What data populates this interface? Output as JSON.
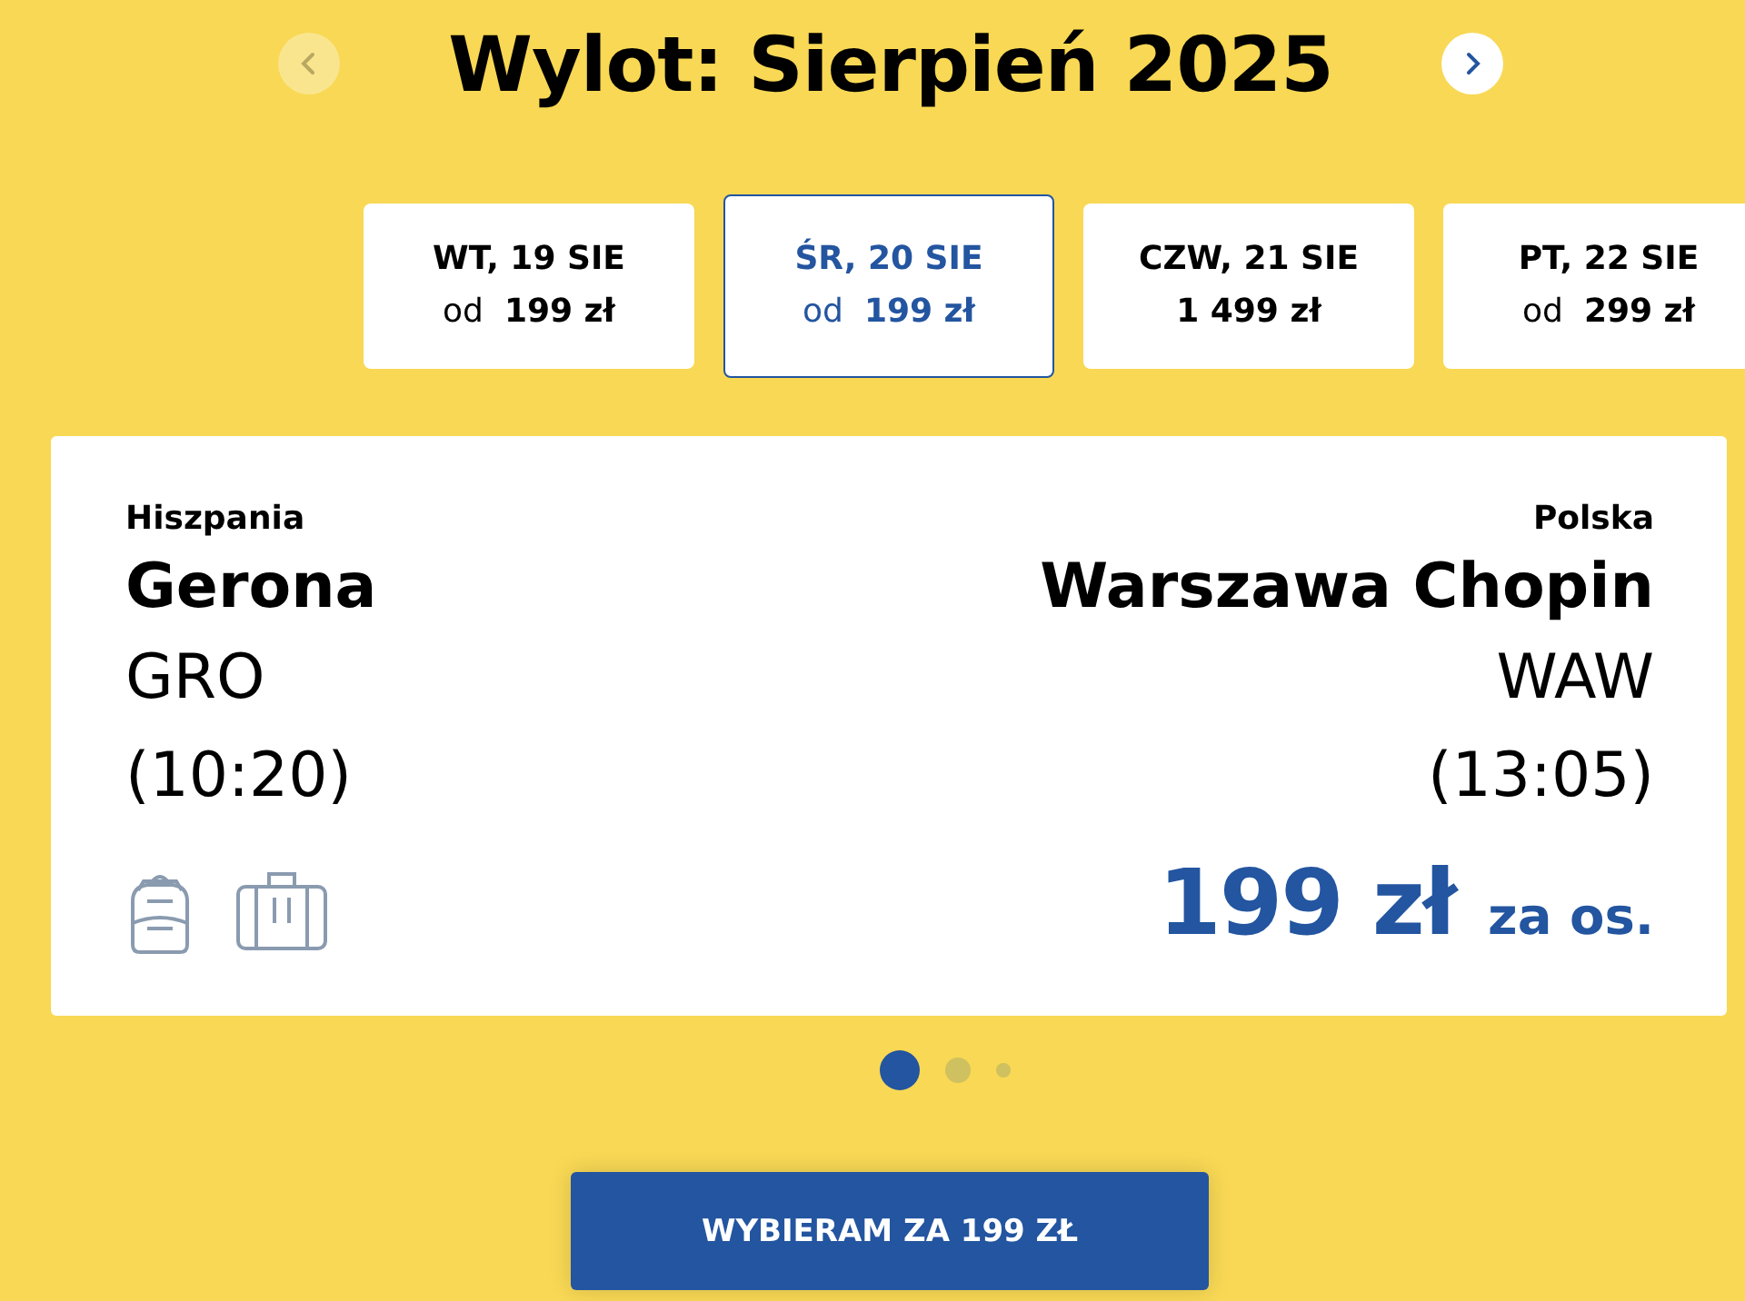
{
  "header": {
    "title": "Wylot: Sierpień 2025",
    "prev_disabled": true,
    "next_disabled": false
  },
  "dates": [
    {
      "label": "WT, 19 SIE",
      "prefix": "od",
      "price": "199 zł",
      "selected": false
    },
    {
      "label": "ŚR, 20 SIE",
      "prefix": "od",
      "price": "199 zł",
      "selected": true
    },
    {
      "label": "CZW, 21 SIE",
      "price": "1 499 zł",
      "selected": false
    },
    {
      "label": "PT, 22 SIE",
      "prefix": "od",
      "price": "299 zł",
      "selected": false
    }
  ],
  "flight": {
    "origin": {
      "country": "Hiszpania",
      "city": "Gerona",
      "code": "GRO",
      "time": "(10:20)"
    },
    "destination": {
      "country": "Polska",
      "city": "Warszawa Chopin",
      "code": "WAW",
      "time": "(13:05)"
    },
    "price": "199 zł",
    "price_suffix": "za os."
  },
  "pager": [
    {
      "selected": true
    },
    {
      "selected": false
    },
    {
      "selected": false
    }
  ],
  "cta": "WYBIERAM ZA 199 ZŁ"
}
